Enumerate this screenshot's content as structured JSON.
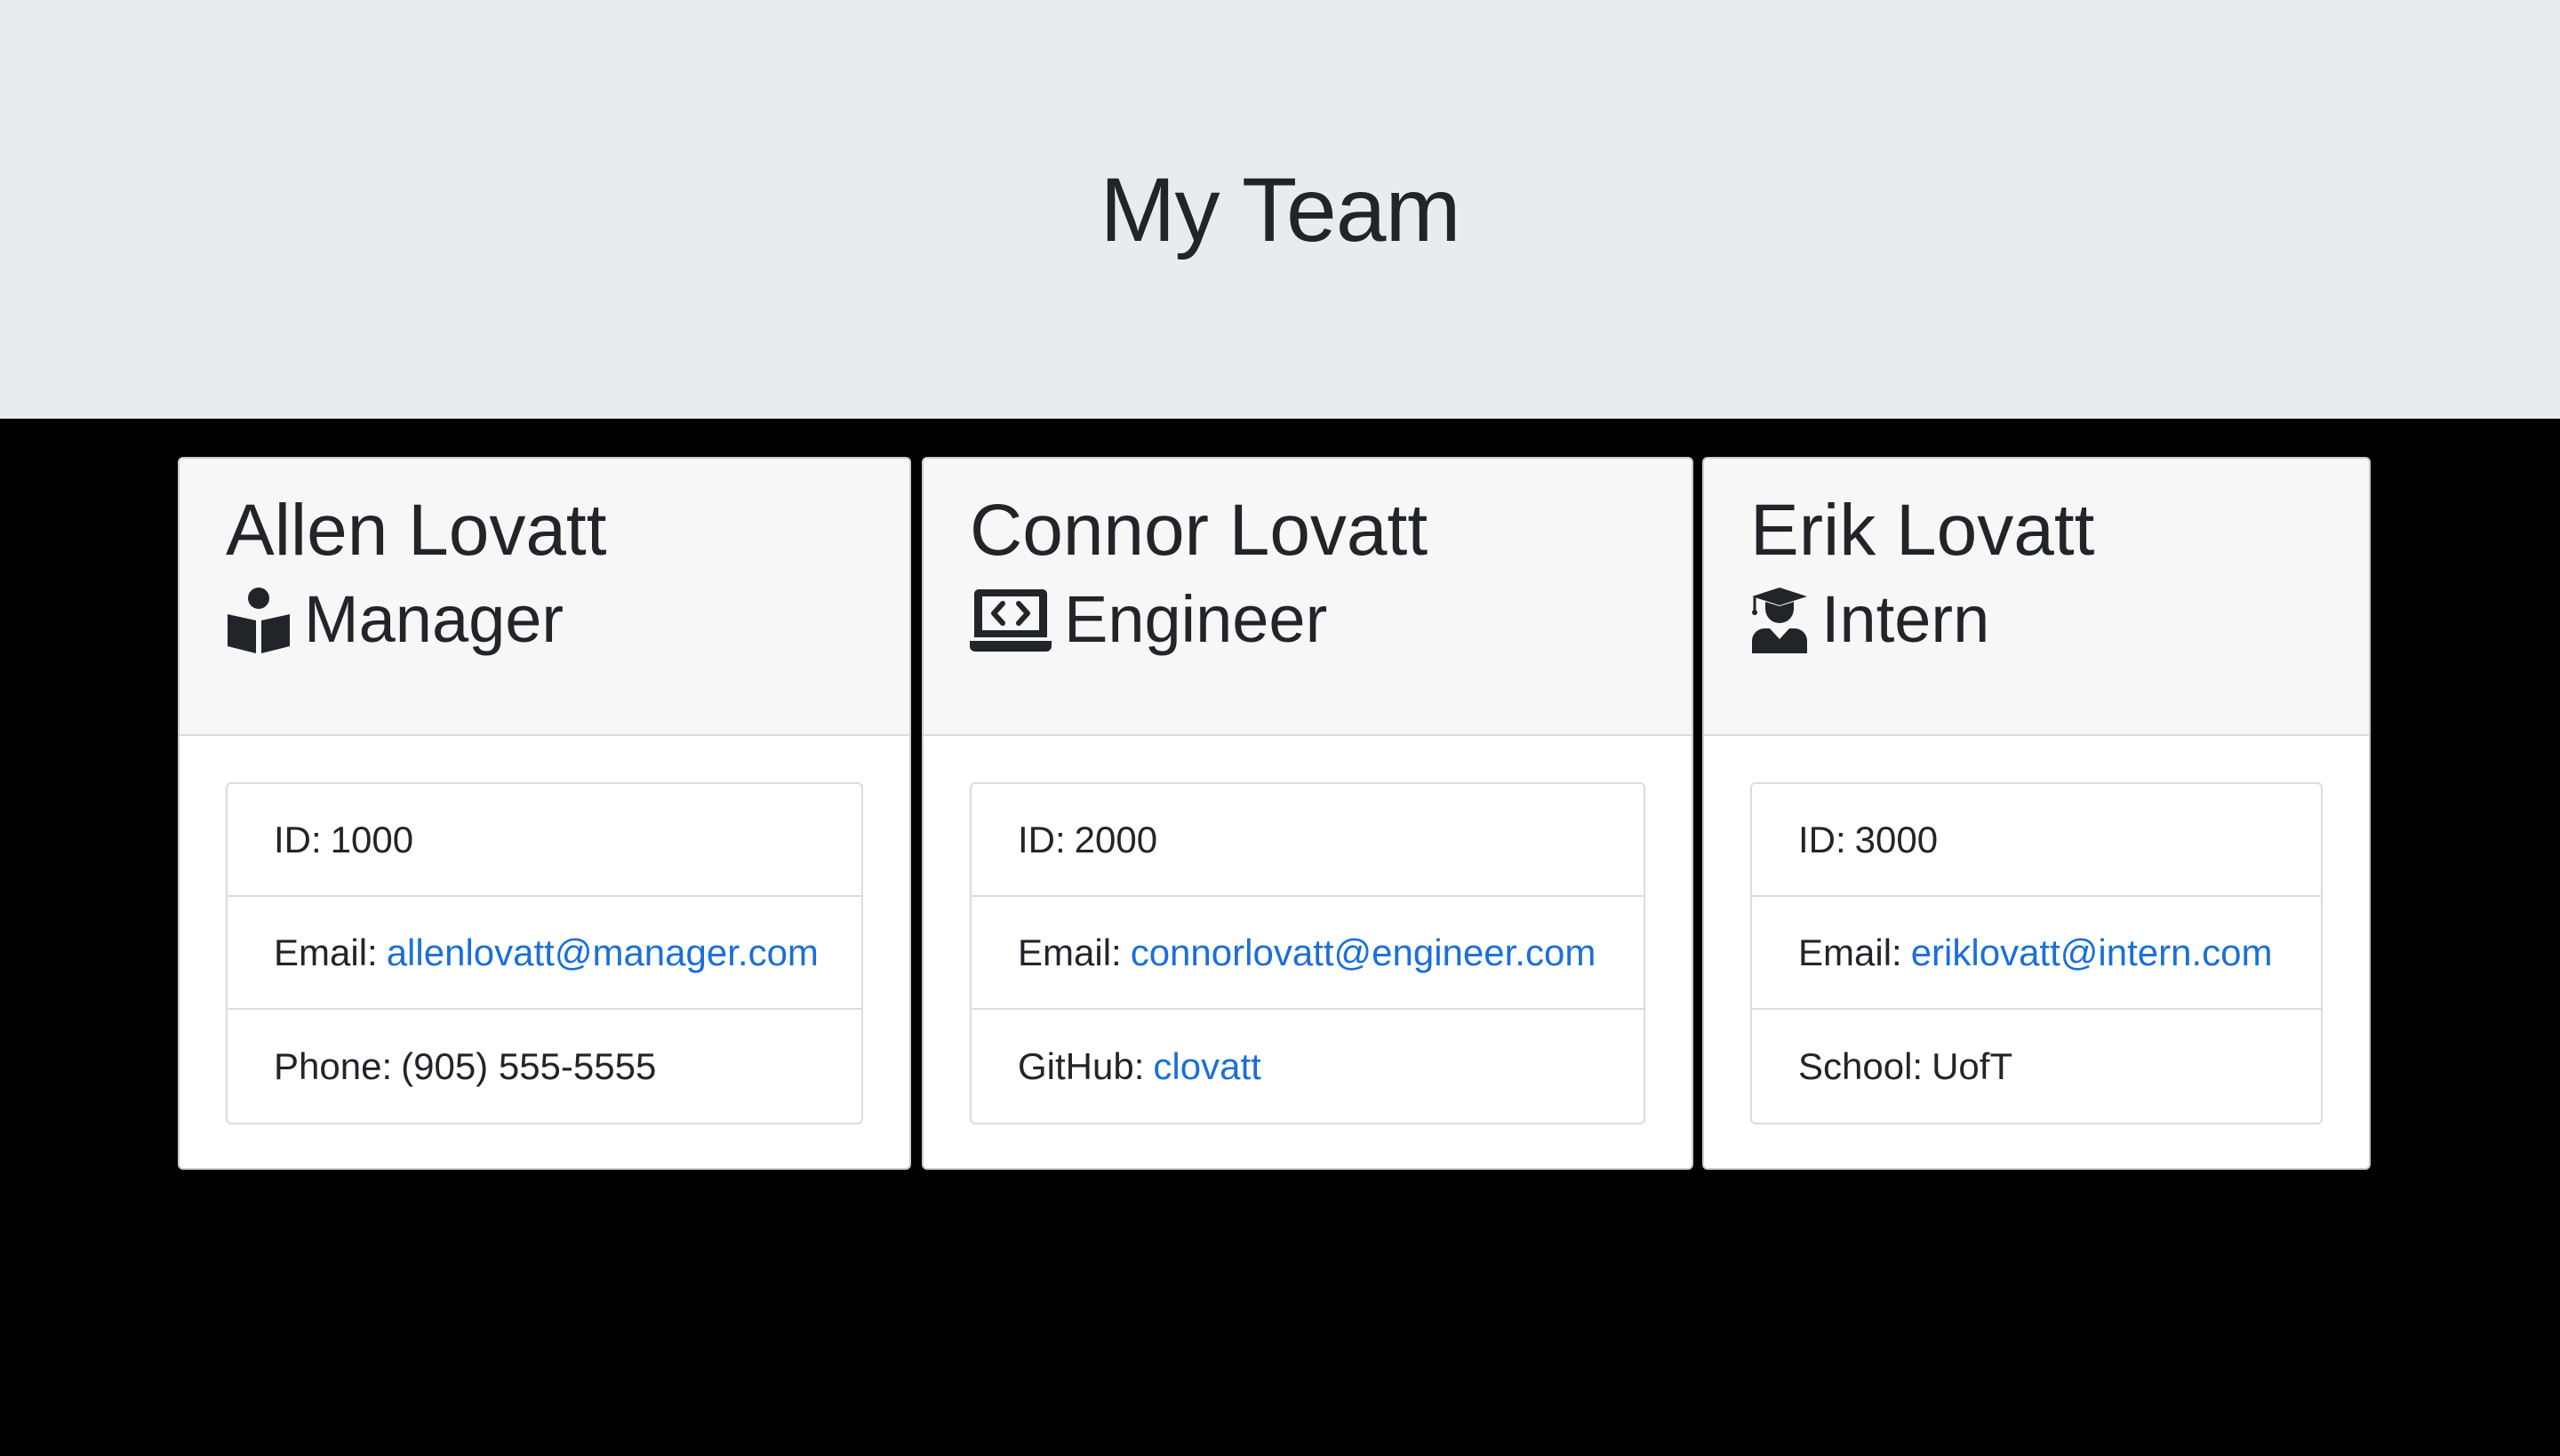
{
  "header": {
    "title": "My Team"
  },
  "colors": {
    "page_background": "#000000",
    "jumbotron_background": "#e9ecef",
    "card_header_background": "#f7f7f7",
    "link": "#1b6fd9",
    "text": "#212529"
  },
  "cards": [
    {
      "name": "Allen Lovatt",
      "role": "Manager",
      "role_icon": "user-book-icon",
      "id_label": "ID:",
      "id_value": "1000",
      "email_label": "Email:",
      "email_value": "allenlovatt@manager.com",
      "extra_label": "Phone:",
      "extra_value": "(905) 555-5555"
    },
    {
      "name": "Connor Lovatt",
      "role": "Engineer",
      "role_icon": "laptop-code-icon",
      "id_label": "ID:",
      "id_value": "2000",
      "email_label": "Email:",
      "email_value": "connorlovatt@engineer.com",
      "extra_label": "GitHub:",
      "extra_value": "clovatt"
    },
    {
      "name": "Erik Lovatt",
      "role": "Intern",
      "role_icon": "user-graduate-icon",
      "id_label": "ID:",
      "id_value": "3000",
      "email_label": "Email:",
      "email_value": "eriklovatt@intern.com",
      "extra_label": "School:",
      "extra_value": "UofT"
    }
  ]
}
